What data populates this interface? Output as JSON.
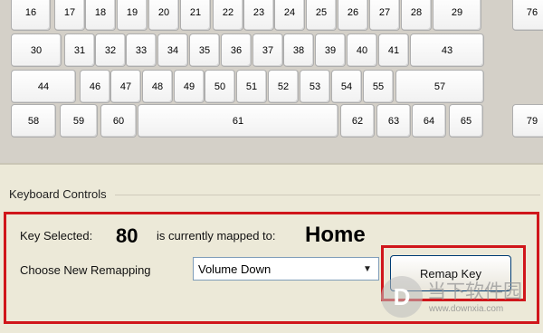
{
  "keyboard": {
    "keys": [
      "16",
      "17",
      "18",
      "19",
      "20",
      "21",
      "22",
      "23",
      "24",
      "25",
      "26",
      "27",
      "28",
      "29",
      "76",
      "30",
      "31",
      "32",
      "33",
      "34",
      "35",
      "36",
      "37",
      "38",
      "39",
      "40",
      "41",
      "43",
      "44",
      "46",
      "47",
      "48",
      "49",
      "50",
      "51",
      "52",
      "53",
      "54",
      "55",
      "57",
      "58",
      "59",
      "60",
      "61",
      "62",
      "63",
      "64",
      "65",
      "79"
    ]
  },
  "controls": {
    "section_title": "Keyboard Controls",
    "key_selected_label": "Key Selected:",
    "key_selected_value": "80",
    "mapped_to_label": "is currently mapped to:",
    "mapped_to_value": "Home",
    "choose_label": "Choose New Remapping",
    "remap_select_value": "Volume Down",
    "remap_button_label": "Remap Key"
  },
  "watermark": {
    "logo_char": "D",
    "text_cn": "当下软件园",
    "url": "www.downxia.com"
  },
  "colors": {
    "highlight_red": "#d0161b",
    "window_bg": "#ece9d8",
    "keyboard_bg": "#d4d0c8"
  }
}
